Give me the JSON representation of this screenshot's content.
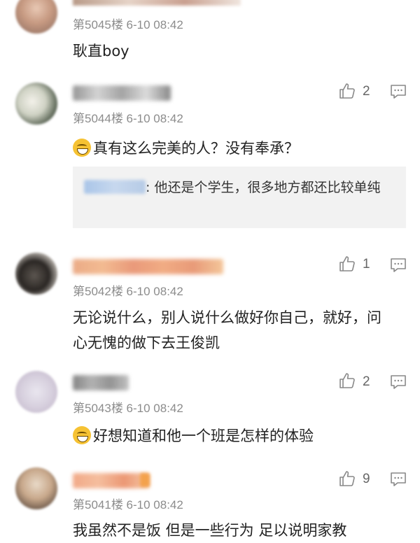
{
  "comments": [
    {
      "floor_time": "第5045楼  6-10 08:42",
      "text": "耿直boy",
      "likes": null
    },
    {
      "floor_time": "第5044楼  6-10 08:42",
      "text": "真有这么完美的人？没有奉承？",
      "likes": "2",
      "reply_text": ": 他还是个学生，很多地方都还比较单纯"
    },
    {
      "floor_time": "第5042楼  6-10 08:42",
      "text": "无论说什么，别人说什么做好你自己，就好，问心无愧的做下去王俊凯",
      "likes": "1"
    },
    {
      "floor_time": "第5043楼  6-10 08:42",
      "text": "好想知道和他一个班是怎样的体验",
      "likes": "2"
    },
    {
      "floor_time": "第5041楼  6-10 08:42",
      "text": "我虽然不是饭 但是一些行为 足以说明家教",
      "likes": "9"
    }
  ],
  "icons": {
    "like": "thumbs-up-icon",
    "reply": "comment-icon",
    "emoji": "laughing-tears-emoji"
  },
  "colors": {
    "meta_text": "#8c8c8c",
    "quote_bg": "#f2f2f2"
  }
}
